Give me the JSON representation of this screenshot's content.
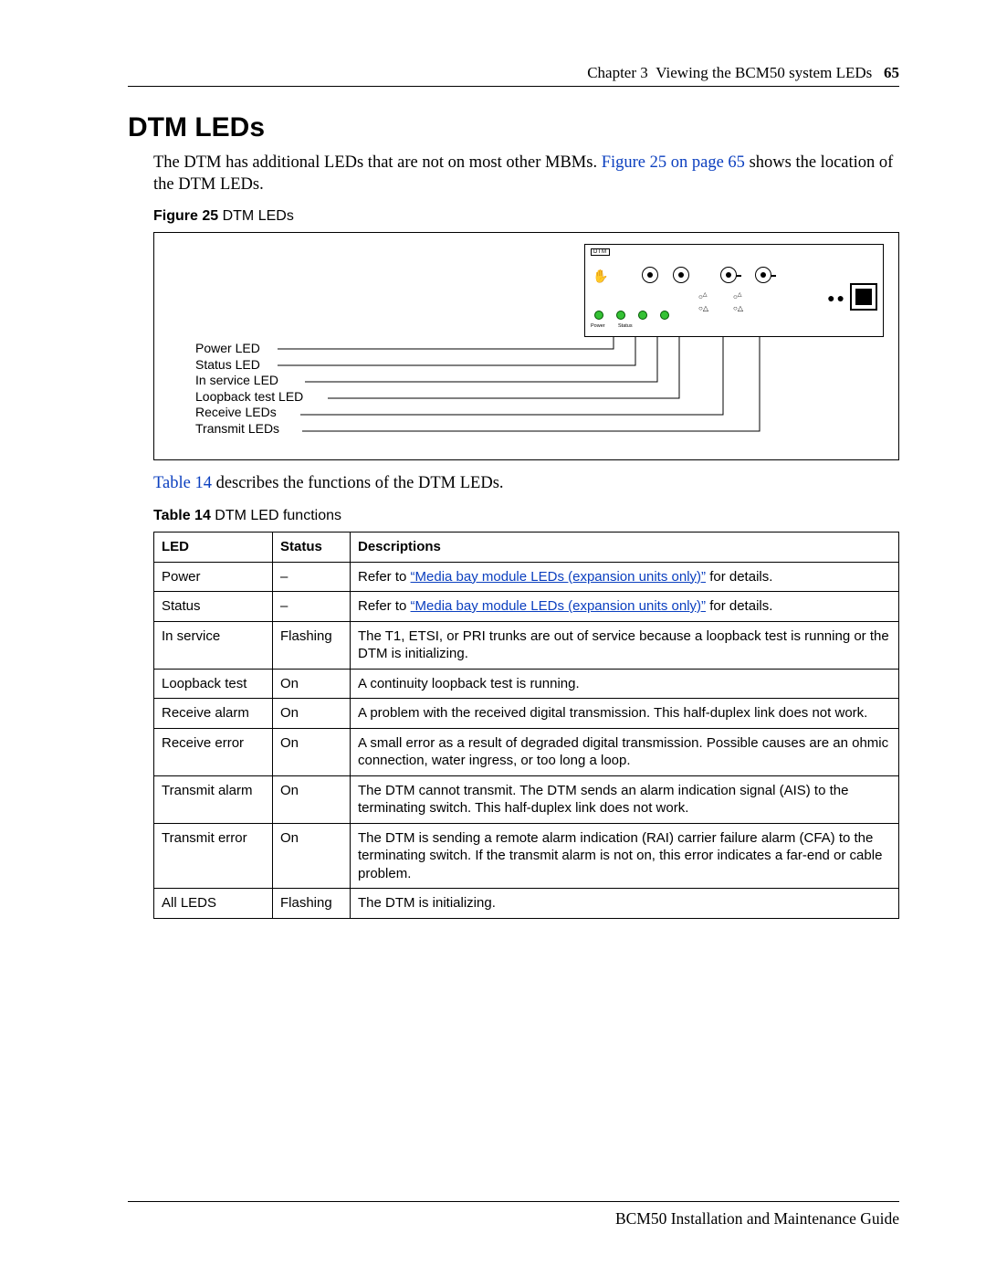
{
  "header": {
    "chapter_label": "Chapter 3",
    "chapter_title": "Viewing the BCM50 system LEDs",
    "page_number": "65"
  },
  "section": {
    "title": "DTM LEDs",
    "intro_before_link": "The DTM has additional LEDs that are not on most other MBMs. ",
    "intro_link": "Figure 25 on page 65",
    "intro_after_link": " shows the location of the DTM LEDs."
  },
  "figure": {
    "label_strong": "Figure 25",
    "label_rest": "   DTM LEDs",
    "panel_tag": "DTM",
    "panel_small_labels": {
      "power": "Power",
      "status": "Status"
    },
    "callouts": [
      "Power LED",
      "Status LED",
      "In service LED",
      "Loopback test LED",
      "Receive LEDs",
      "Transmit LEDs"
    ]
  },
  "after_figure": {
    "link": "Table 14",
    "rest": " describes the functions of the DTM LEDs."
  },
  "table": {
    "caption_strong": "Table 14",
    "caption_rest": "   DTM LED functions",
    "headers": {
      "led": "LED",
      "status": "Status",
      "desc": "Descriptions"
    },
    "link_text": "“Media bay module LEDs (expansion units only)”",
    "rows": [
      {
        "led": "Power",
        "status": "–",
        "pre": "Refer to ",
        "post": " for details.",
        "is_link_row": true
      },
      {
        "led": "Status",
        "status": "–",
        "pre": "Refer to ",
        "post": " for details.",
        "is_link_row": true
      },
      {
        "led": "In service",
        "status": "Flashing",
        "desc": "The T1, ETSI, or PRI trunks are out of service because a loopback test is running or the DTM is initializing."
      },
      {
        "led": "Loopback test",
        "status": "On",
        "desc": "A continuity loopback test is running."
      },
      {
        "led": "Receive alarm",
        "status": "On",
        "desc": "A problem with the received digital transmission. This half-duplex link does not work."
      },
      {
        "led": "Receive error",
        "status": "On",
        "desc": "A small error as a result of degraded digital transmission. Possible causes are an ohmic connection, water ingress, or too long a loop."
      },
      {
        "led": "Transmit alarm",
        "status": "On",
        "desc": "The DTM cannot transmit. The DTM sends an alarm indication signal (AIS) to the terminating switch. This half-duplex link does not work."
      },
      {
        "led": "Transmit error",
        "status": "On",
        "desc": "The DTM is sending a remote alarm indication (RAI) carrier failure alarm (CFA) to the terminating switch. If the transmit alarm is not on, this error indicates a far-end or cable problem."
      },
      {
        "led": "All LEDS",
        "status": "Flashing",
        "desc": "The DTM is initializing."
      }
    ]
  },
  "footer": {
    "text": "BCM50 Installation and Maintenance Guide"
  }
}
